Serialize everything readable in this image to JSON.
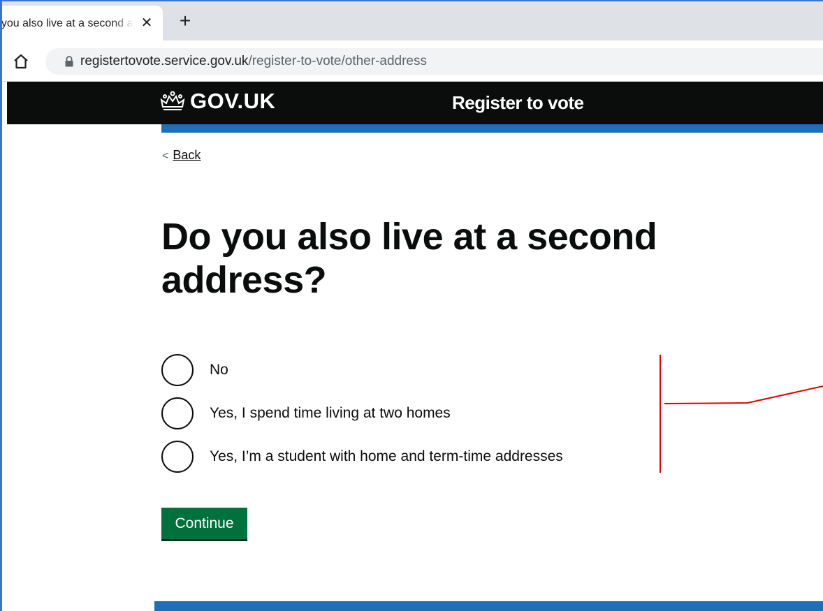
{
  "browser": {
    "tab_title": "Do you also live at a second address?",
    "tab_close": "✕",
    "new_tab": "+",
    "url_host": "registertovote.service.gov.uk",
    "url_path": "/register-to-vote/other-address"
  },
  "header": {
    "logo_text": "GOV.UK",
    "service_name": "Register to vote"
  },
  "back_link": {
    "label": "Back"
  },
  "question": {
    "heading": "Do you also live at a second address?",
    "options": [
      {
        "label": "No",
        "selected": false
      },
      {
        "label": "Yes, I spend time living at two homes",
        "selected": false
      },
      {
        "label": "Yes, I’m a student with home and term-time addresses",
        "selected": false
      }
    ]
  },
  "actions": {
    "continue_label": "Continue"
  },
  "colors": {
    "header_bg": "#0b0c0c",
    "header_underline": "#1d70b8",
    "button_green": "#00703c",
    "annotation_red": "#e00000"
  },
  "icons": {
    "tab_close": "close-icon",
    "new_tab": "plus-icon",
    "home": "home-icon",
    "lock": "lock-icon",
    "crown": "crown-icon",
    "back": "chevron-left-icon"
  }
}
